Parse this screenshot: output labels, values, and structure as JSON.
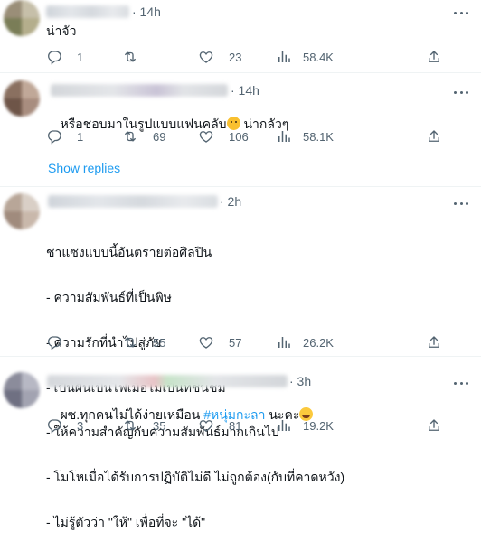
{
  "replies": [
    {
      "time": "· 14h",
      "text": "น่าจัว",
      "stats": {
        "reply": "1",
        "retweet": "",
        "like": "23",
        "views": "58.4K"
      }
    },
    {
      "time": "· 14h",
      "text": "หรือชอบมาในรูปแบบแฟนคลับ",
      "text_suffix": " น่ากลัวๆ",
      "stats": {
        "reply": "1",
        "retweet": "69",
        "like": "106",
        "views": "58.1K"
      }
    },
    {
      "time": "· 2h",
      "lines": [
        "ชาแซงแบบนี้อันตรายต่อศิลปิน",
        "- ความสัมพันธ์ที่เป็นพิษ",
        "- ความรักที่นำไปสู่ภัย",
        "- เป็นฝันเป็นไฟเมื่อไม่เป็นที่ชื่นชม",
        "- ให้ความสำคัญกับความสัมพันธ์มากเกินไป",
        "- โมโหเมื่อได้รับการปฏิบัติไม่ดี ไม่ถูกต้อง(กับที่คาดหวัง)",
        "- ไม่รู้ตัวว่า \"ให้\" เพื่อที่จะ \"ได้\""
      ],
      "stats": {
        "reply": "",
        "retweet": "55",
        "like": "57",
        "views": "26.2K"
      }
    },
    {
      "time": "· 3h",
      "text": "ผซ.ทุกคนไม่ได้ง่ายเหมือน ",
      "hashtag": "#หนุ่มกะลา",
      "text_suffix": " นะคะ",
      "stats": {
        "reply": "3",
        "retweet": "35",
        "like": "81",
        "views": "19.2K"
      }
    }
  ],
  "show_replies": "Show replies",
  "colors": {
    "accent": "#1d9bf0",
    "muted": "#536471",
    "text": "#0f1419"
  },
  "icons": [
    "reply-icon",
    "retweet-icon",
    "like-icon",
    "views-icon",
    "share-icon",
    "more-icon",
    "thinking-emoji",
    "laughing-emoji"
  ]
}
